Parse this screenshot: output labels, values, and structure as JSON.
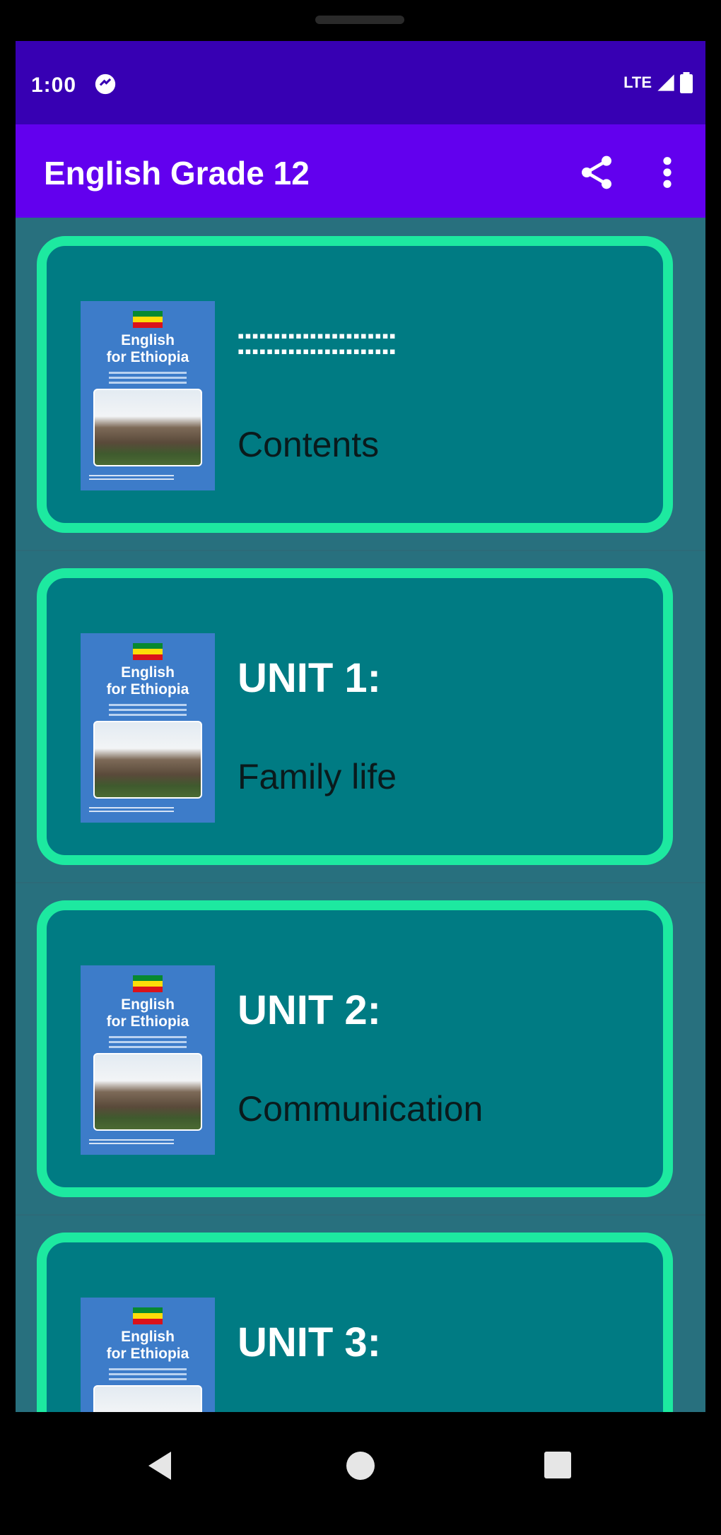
{
  "status_bar": {
    "time": "1:00",
    "network": "LTE"
  },
  "app_bar": {
    "title": "English Grade 12",
    "share_icon": "share-icon",
    "more_icon": "more-vert-icon"
  },
  "colors": {
    "status_bar": "#3700b3",
    "app_bar": "#6200ee",
    "background": "#28707e",
    "card": "#007b83",
    "card_border": "#1de9a0",
    "thumbnail": "#3d7cc9"
  },
  "thumbnail": {
    "book_title_line1": "English",
    "book_title_line2": "for Ethiopia"
  },
  "items": [
    {
      "title": "▪▪▪▪▪▪▪▪▪▪▪▪▪▪▪▪▪▪▪▪▪▪\n▪▪▪▪▪▪▪▪▪▪▪▪▪▪▪▪▪▪▪▪▪▪",
      "subtitle": "Contents"
    },
    {
      "title": "UNIT 1:",
      "subtitle": "Family life"
    },
    {
      "title": "UNIT 2:",
      "subtitle": "Communication"
    },
    {
      "title": "UNIT 3:",
      "subtitle": ""
    }
  ],
  "nav_bar": {
    "back_icon": "back-triangle-icon",
    "home_icon": "home-circle-icon",
    "recents_icon": "recents-square-icon"
  }
}
